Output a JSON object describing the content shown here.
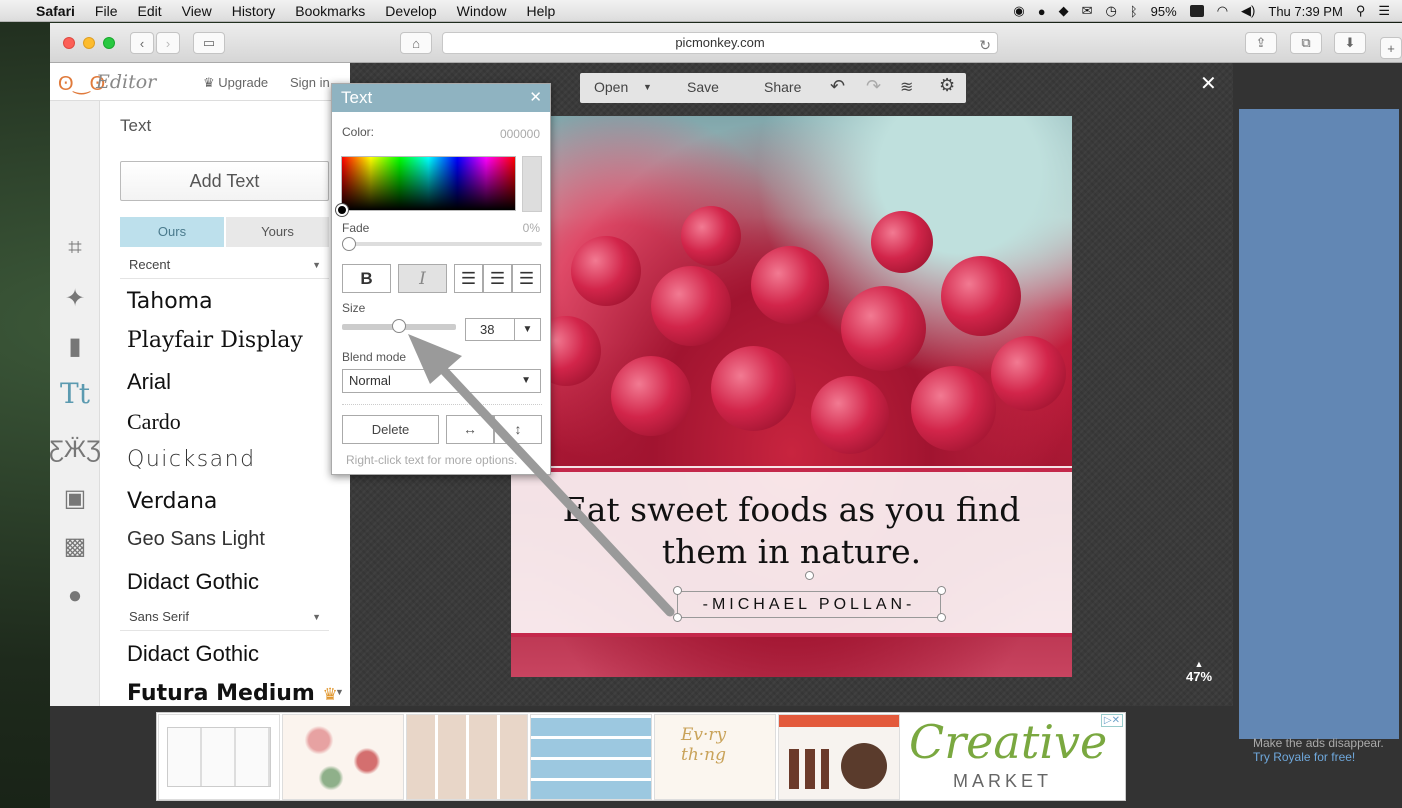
{
  "menubar": {
    "items": [
      "Safari",
      "File",
      "Edit",
      "View",
      "History",
      "Bookmarks",
      "Develop",
      "Window",
      "Help"
    ],
    "battery": "95%",
    "clock": "Thu 7:39 PM"
  },
  "browser": {
    "url": "picmonkey.com"
  },
  "editor": {
    "app_name": "Editor",
    "upgrade_label": "Upgrade",
    "signin_label": "Sign in",
    "toolbar": {
      "open_label": "Open",
      "save_label": "Save",
      "share_label": "Share"
    },
    "zoom": "47%"
  },
  "text_panel": {
    "title": "Text",
    "add_text_label": "Add Text",
    "tabs": [
      "Ours",
      "Yours"
    ],
    "recent_label": "Recent",
    "fonts_recent": [
      "Tahoma",
      "Playfair Display",
      "Arial",
      "Cardo",
      "Quicksand",
      "Verdana",
      "Geo Sans Light",
      "Didact Gothic"
    ],
    "category_label": "Sans Serif",
    "fonts_category": [
      "Didact Gothic",
      "Futura Medium"
    ]
  },
  "text_dialog": {
    "title": "Text",
    "color_label": "Color:",
    "color_value": "000000",
    "fade_label": "Fade",
    "fade_value": "0%",
    "bold_glyph": "B",
    "italic_glyph": "I",
    "size_label": "Size",
    "size_value": "38",
    "size_fraction": 0.5,
    "blend_label": "Blend mode",
    "blend_value": "Normal",
    "delete_label": "Delete",
    "hint": "Right-click text for more options."
  },
  "canvas": {
    "quote_line1": "Eat sweet foods as you find",
    "quote_line2": "them in nature.",
    "author": "-MICHAEL POLLAN-"
  },
  "ads": {
    "creative_market_title": "Creative",
    "creative_market_sub": "MARKET",
    "note_line": "Make the ads disappear.",
    "note_link": "Try Royale for free!"
  },
  "colors": {
    "accent": "#5b9ab0",
    "dialog_header": "#8fb3c1",
    "tab_active": "#bde0ec",
    "right_ad": "#6287b4"
  }
}
